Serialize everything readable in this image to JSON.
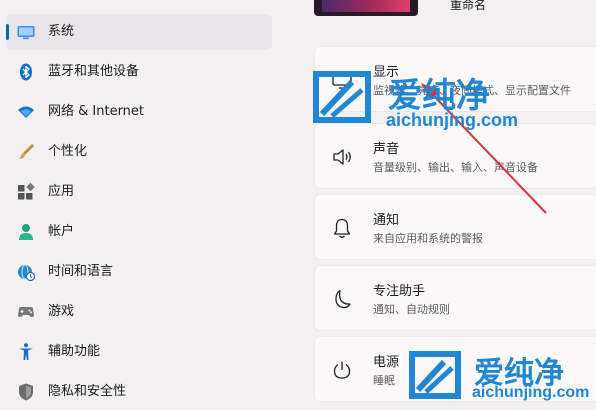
{
  "sidebar": {
    "items": [
      {
        "label": "系统",
        "icon": "monitor-icon"
      },
      {
        "label": "蓝牙和其他设备",
        "icon": "bluetooth-icon"
      },
      {
        "label": "网络 & Internet",
        "icon": "wifi-icon"
      },
      {
        "label": "个性化",
        "icon": "brush-icon"
      },
      {
        "label": "应用",
        "icon": "apps-icon"
      },
      {
        "label": "帐户",
        "icon": "person-icon"
      },
      {
        "label": "时间和语言",
        "icon": "globe-clock-icon"
      },
      {
        "label": "游戏",
        "icon": "gamepad-icon"
      },
      {
        "label": "辅助功能",
        "icon": "accessibility-icon"
      },
      {
        "label": "隐私和安全性",
        "icon": "shield-icon"
      }
    ]
  },
  "main": {
    "rename_label": "重命名",
    "cards": [
      {
        "title": "显示",
        "subtitle": "监视器、亮度、夜间模式、显示配置文件",
        "icon": "display-icon"
      },
      {
        "title": "声音",
        "subtitle": "音量级别、输出、输入、声音设备",
        "icon": "speaker-icon"
      },
      {
        "title": "通知",
        "subtitle": "来自应用和系统的警报",
        "icon": "bell-icon"
      },
      {
        "title": "专注助手",
        "subtitle": "通知、自动规则",
        "icon": "moon-icon"
      },
      {
        "title": "电源",
        "subtitle": "睡眠",
        "icon": "power-icon"
      }
    ]
  },
  "watermark": {
    "text": "爱纯净",
    "url": "aichunjing.com"
  },
  "colors": {
    "accent": "#0067c0",
    "watermark": "#2187d4",
    "arrow": "#d8343a"
  }
}
